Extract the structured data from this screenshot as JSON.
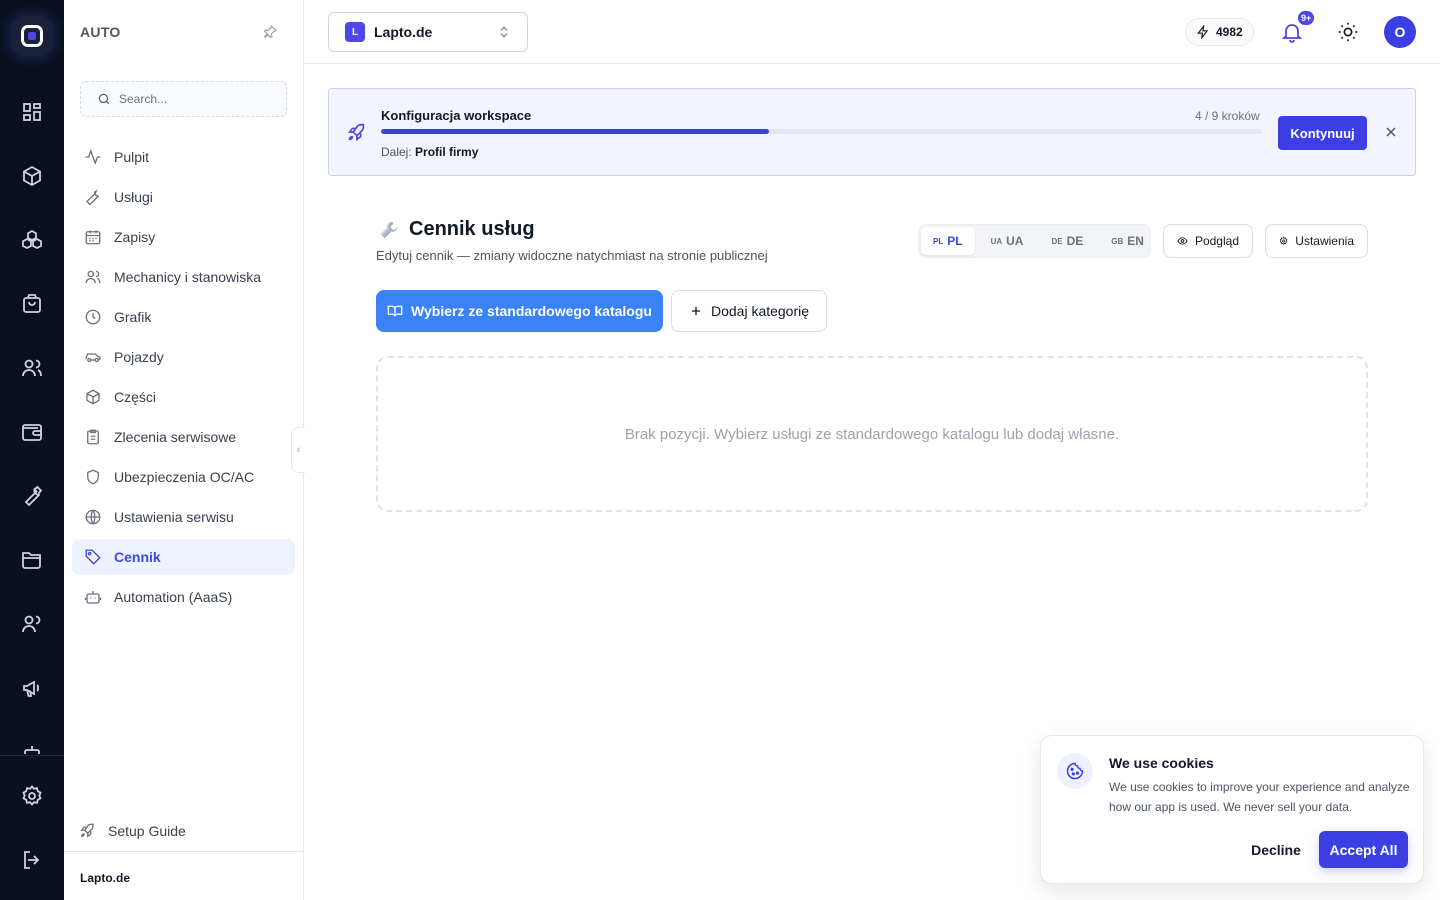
{
  "rail": {
    "icons": [
      "dashboard-icon",
      "box-icon",
      "modules-icon",
      "shopping-bag-icon",
      "users-icon",
      "wallet-icon",
      "wrench-icon",
      "folder-icon",
      "team-icon",
      "megaphone-icon",
      "settings-icon",
      "logout-icon"
    ]
  },
  "sidebar": {
    "section_title": "AUTO",
    "search_placeholder": "Search...",
    "items": [
      {
        "label": "Pulpit",
        "icon": "activity-icon"
      },
      {
        "label": "Usługi",
        "icon": "wrench-icon"
      },
      {
        "label": "Zapisy",
        "icon": "calendar-icon"
      },
      {
        "label": "Mechanicy i stanowiska",
        "icon": "users-icon"
      },
      {
        "label": "Grafik",
        "icon": "clock-icon"
      },
      {
        "label": "Pojazdy",
        "icon": "car-icon"
      },
      {
        "label": "Części",
        "icon": "package-icon"
      },
      {
        "label": "Zlecenia serwisowe",
        "icon": "clipboard-icon"
      },
      {
        "label": "Ubezpieczenia OC/AC",
        "icon": "shield-icon"
      },
      {
        "label": "Ustawienia serwisu",
        "icon": "globe-icon"
      },
      {
        "label": "Cennik",
        "icon": "tag-icon",
        "active": true
      },
      {
        "label": "Automation (AaaS)",
        "icon": "bot-icon"
      }
    ],
    "setup_guide": "Setup Guide",
    "footer_workspace": "Lapto.de"
  },
  "topbar": {
    "workspace_initial": "L",
    "workspace_name": "Lapto.de",
    "credits": "4982",
    "notifications_badge": "9+",
    "avatar_initial": "O"
  },
  "banner": {
    "title": "Konfiguracja workspace",
    "steps": "4 / 9 kroków",
    "progress": 0.44,
    "next_label": "Dalej:",
    "next_value": "Profil firmy",
    "continue_label": "Kontynuuj"
  },
  "main": {
    "title": "Cennik usług",
    "subtitle": "Edytuj cennik — zmiany widoczne natychmiast na stronie publicznej",
    "languages": [
      {
        "code": "PL",
        "label": "PL",
        "active": true
      },
      {
        "code": "UA",
        "label": "UA"
      },
      {
        "code": "DE",
        "label": "DE"
      },
      {
        "code": "GB",
        "label": "EN"
      }
    ],
    "preview_label": "Podgląd",
    "settings_label": "Ustawienia",
    "catalog_button": "Wybierz ze standardowego katalogu",
    "add_category_button": "Dodaj kategorię",
    "empty_text": "Brak pozycji. Wybierz usługi ze standardowego katalogu lub dodaj własne."
  },
  "cookie": {
    "title": "We use cookies",
    "text": "We use cookies to improve your experience and analyze how our app is used. We never sell your data.",
    "decline": "Decline",
    "accept": "Accept All"
  },
  "colors": {
    "accent": "#3b3fe4",
    "primary_button": "#3b82f6",
    "rail_bg": "#0b1020",
    "active_nav_bg": "#eef1ff"
  }
}
